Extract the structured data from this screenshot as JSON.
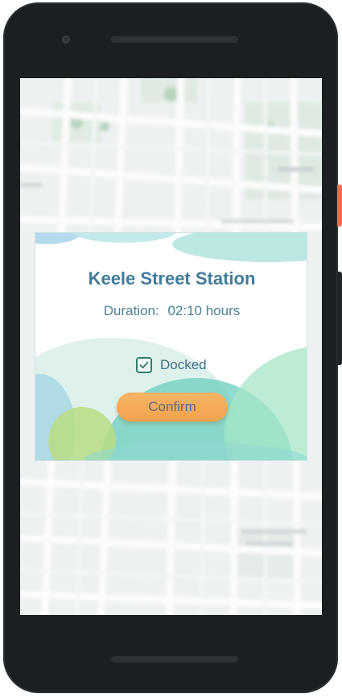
{
  "dialog": {
    "station_name": "Keele Street Station",
    "duration_label": "Duration:",
    "duration_value": "02:10 hours",
    "docked_label": "Docked",
    "docked_checked": true,
    "confirm_label": "Confirm"
  },
  "colors": {
    "title": "#3e7c9a",
    "confirm_button": "#f4ab58",
    "phone_body": "#1b1f22",
    "side_button": "#e8704a"
  }
}
